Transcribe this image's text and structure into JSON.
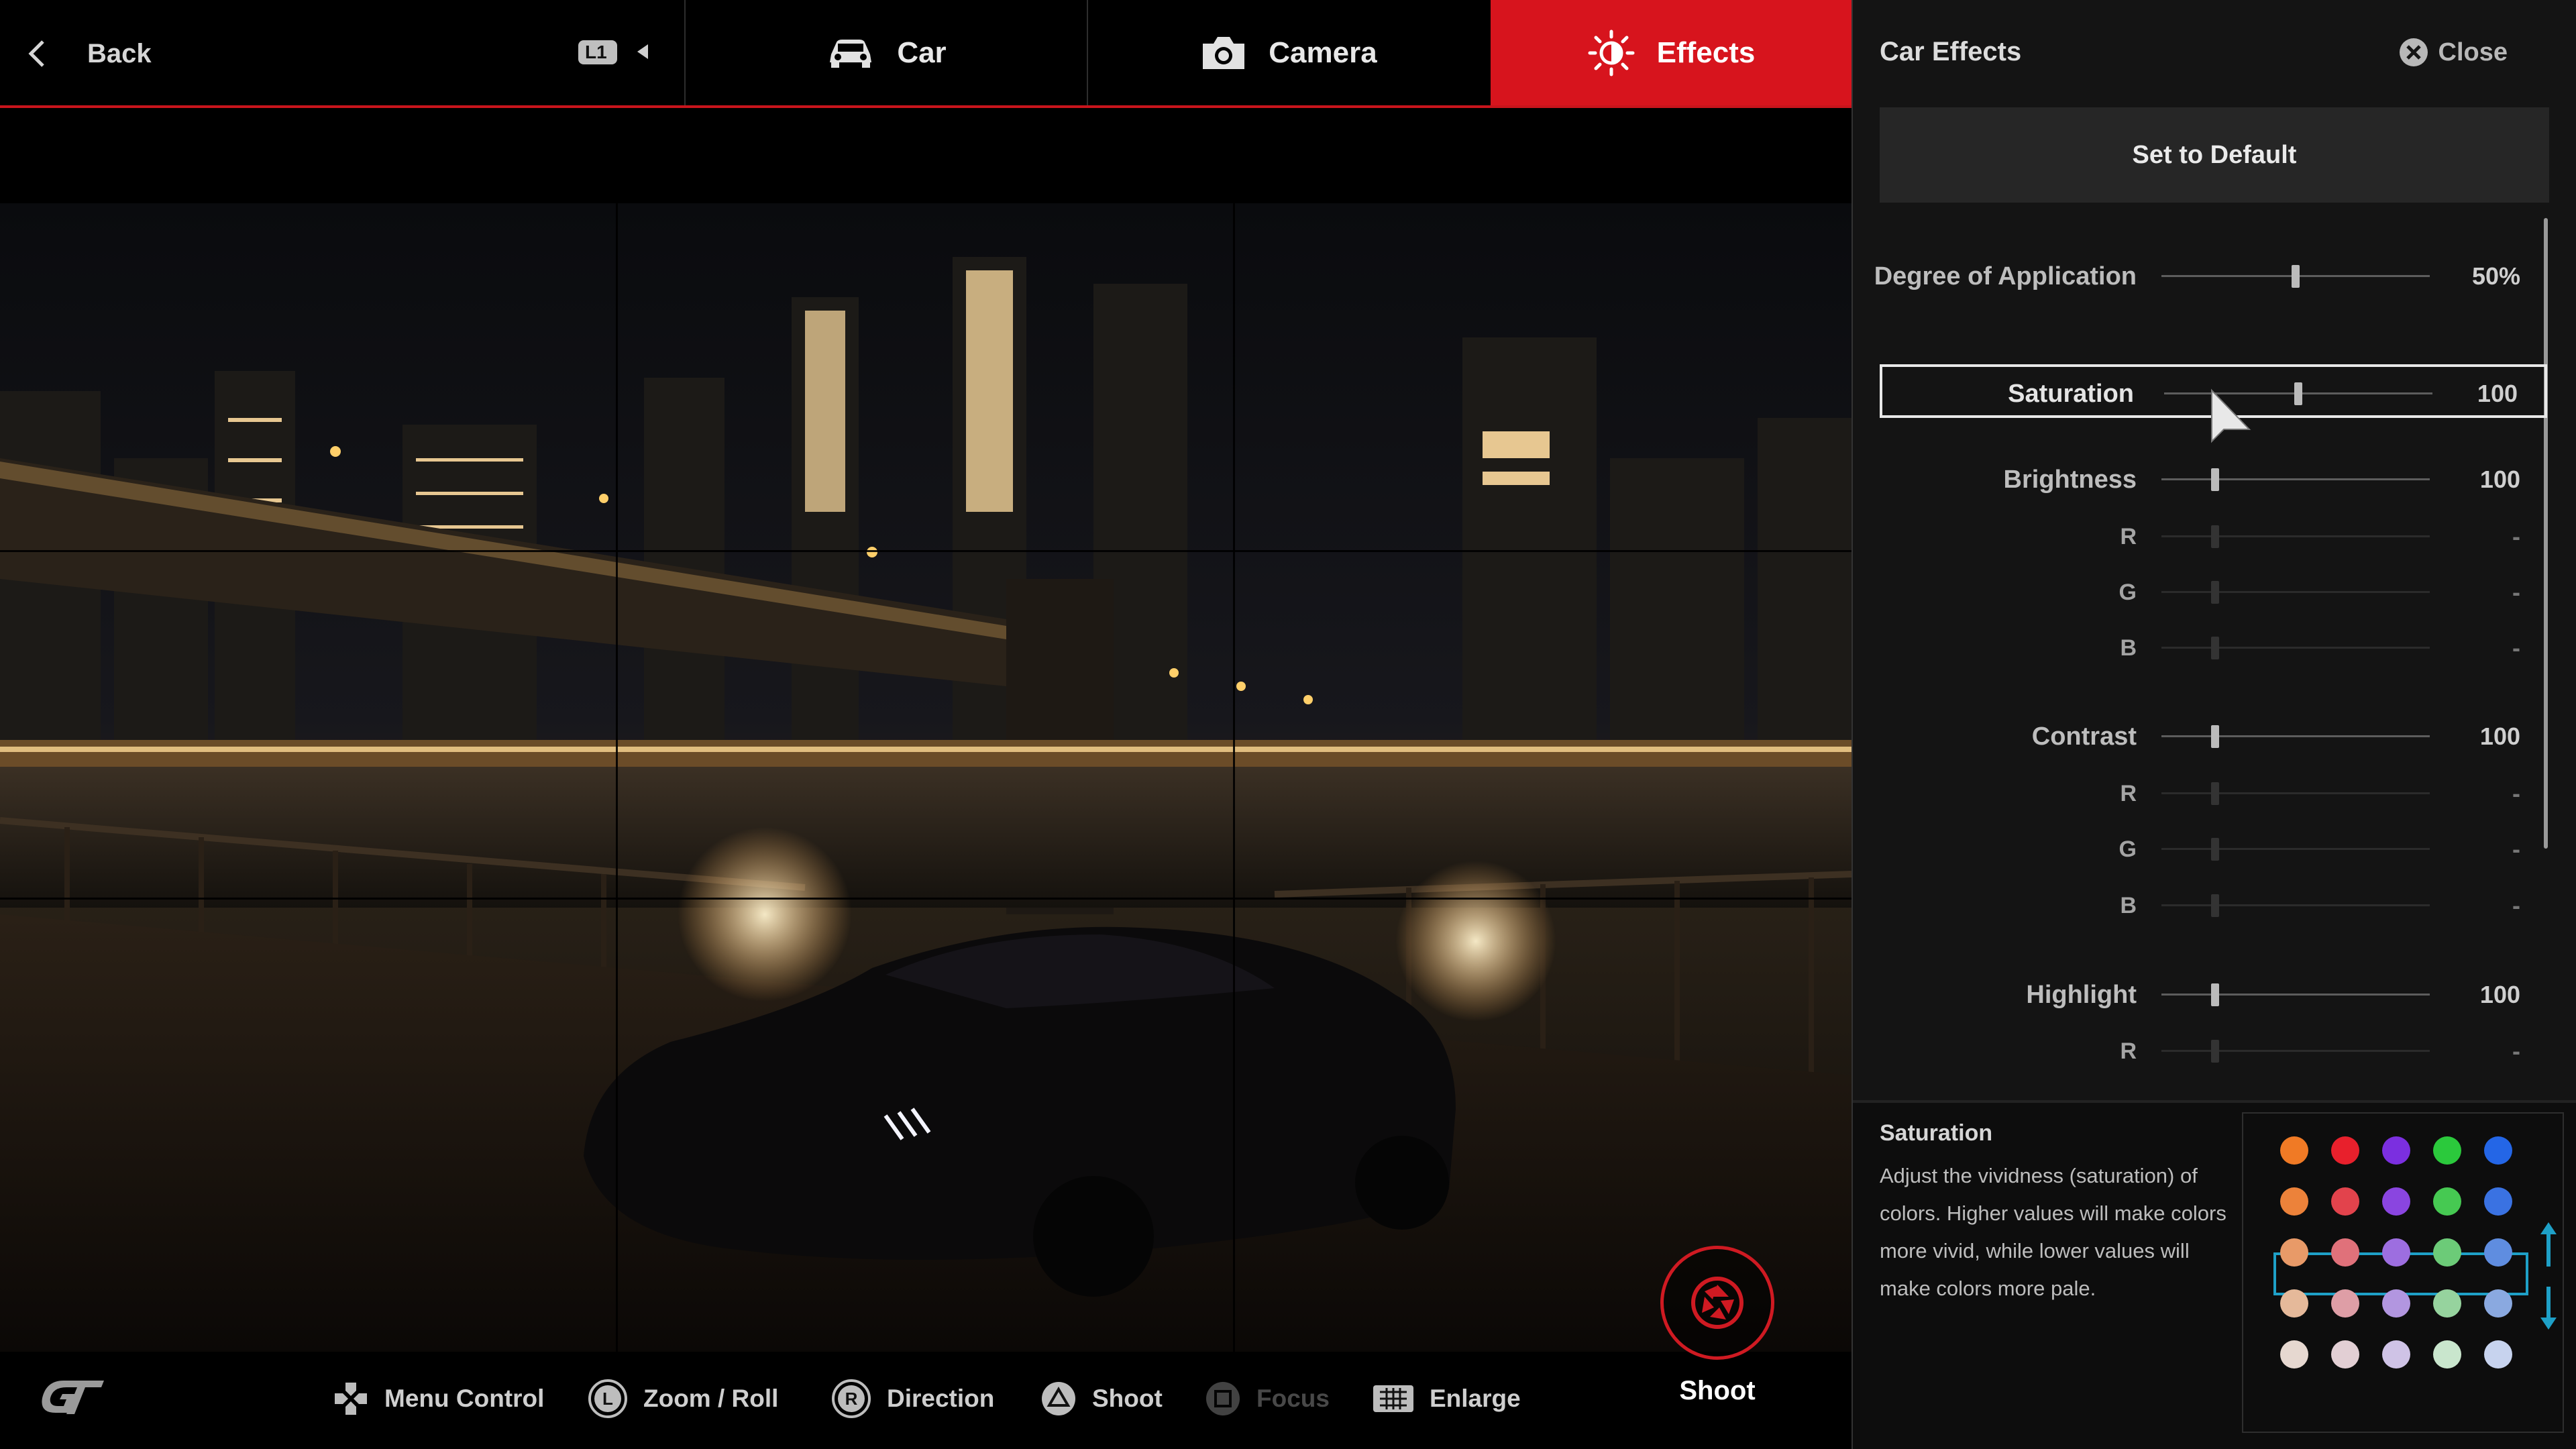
{
  "topbar": {
    "back_label": "Back",
    "l1_label": "L1",
    "tabs": [
      {
        "label": "Car",
        "icon": "car-icon"
      },
      {
        "label": "Camera",
        "icon": "camera-icon"
      },
      {
        "label": "Effects",
        "icon": "brightness-icon",
        "active": true
      }
    ]
  },
  "viewer": {
    "shoot_label": "Shoot",
    "hints": [
      {
        "label": "Menu Control",
        "icon": "dpad-icon"
      },
      {
        "label": "Zoom / Roll",
        "icon": "l-stick-icon"
      },
      {
        "label": "Direction",
        "icon": "r-stick-icon"
      },
      {
        "label": "Shoot",
        "icon": "triangle-button-icon"
      },
      {
        "label": "Focus",
        "icon": "square-button-icon"
      },
      {
        "label": "Enlarge",
        "icon": "touchpad-icon"
      }
    ]
  },
  "panel": {
    "title": "Car Effects",
    "close_label": "Close",
    "default_label": "Set to Default",
    "rows": [
      {
        "label": "Degree of Application",
        "value": "50%",
        "level": 0.5
      },
      {
        "label": "Saturation",
        "value": "100",
        "level": 0.5,
        "selected": true
      },
      {
        "label": "Brightness",
        "value": "100",
        "level": 0.2
      },
      {
        "label": "R",
        "value": "-",
        "level": 0.2,
        "sub": true
      },
      {
        "label": "G",
        "value": "-",
        "level": 0.2,
        "sub": true
      },
      {
        "label": "B",
        "value": "-",
        "level": 0.2,
        "sub": true
      },
      {
        "label": "Contrast",
        "value": "100",
        "level": 0.2
      },
      {
        "label": "R",
        "value": "-",
        "level": 0.2,
        "sub": true
      },
      {
        "label": "G",
        "value": "-",
        "level": 0.2,
        "sub": true
      },
      {
        "label": "B",
        "value": "-",
        "level": 0.2,
        "sub": true
      },
      {
        "label": "Highlight",
        "value": "100",
        "level": 0.2
      },
      {
        "label": "R",
        "value": "-",
        "level": 0.2,
        "sub": true
      }
    ],
    "info": {
      "title": "Saturation",
      "text": "Adjust the vividness (saturation) of colors. Higher values will make colors more vivid, while lower values will make colors more pale."
    },
    "palette": [
      [
        "#f07a25",
        "#e8202c",
        "#7b2fe0",
        "#2bc93c",
        "#2466e6"
      ],
      [
        "#ec823a",
        "#e2434c",
        "#8a45e0",
        "#46c952",
        "#3a72e2"
      ],
      [
        "#e89a68",
        "#e0717a",
        "#9d6ee0",
        "#6ccb78",
        "#5f8de0"
      ],
      [
        "#e5b99a",
        "#de9ea6",
        "#b296e0",
        "#96d39e",
        "#8aa9e0"
      ],
      [
        "#e6d8d0",
        "#e2cfd4",
        "#cfc3e6",
        "#c9e6cd",
        "#c7d3ee"
      ]
    ]
  }
}
